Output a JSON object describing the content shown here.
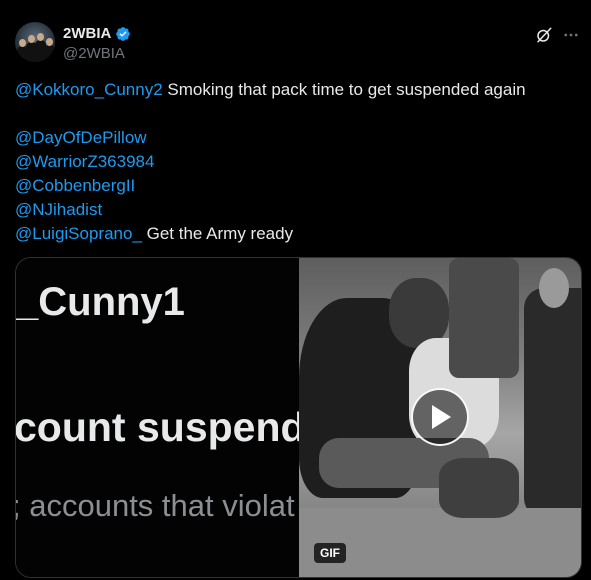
{
  "author": {
    "display_name": "2WBIA",
    "handle": "@2WBIA",
    "avatar_icon": "avatar-men-in-suits-image",
    "verified_icon": "verified-badge-icon"
  },
  "actions": {
    "grok_icon": "grok-icon",
    "more_icon": "more-options-icon"
  },
  "tweet": {
    "line1_mention": "@Kokkoro_Cunny2",
    "line1_text": " Smoking that pack time to get suspended again",
    "mentions": [
      "@DayOfDePillow",
      "@WarriorZ363984",
      "@CobbenbergII",
      "@NJihadist"
    ],
    "last_mention": "@LuigiSoprano_",
    "last_text": " Get the Army ready"
  },
  "media": {
    "left_text_1": "_Cunny1",
    "left_text_2": "count suspend",
    "left_text_3": "; accounts that violat",
    "play_icon": "play-icon",
    "badge": "GIF"
  },
  "colors": {
    "link": "#1d9bf0",
    "text": "#e7e9ea",
    "muted": "#71767b",
    "background": "#000000",
    "border": "#2f3336"
  }
}
